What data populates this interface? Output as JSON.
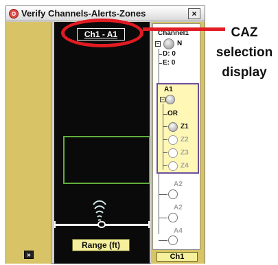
{
  "window": {
    "title": "Verify Channels-Alerts-Zones",
    "close_label": "×"
  },
  "left_panel": {
    "expand_label": "»"
  },
  "sonar": {
    "caz_display": "Ch1 - A1",
    "range_button": "Range (ft)"
  },
  "tree": {
    "channel_label": "Channel1",
    "channel_node": "N",
    "d_label": "D: 0",
    "e_label": "E: 0",
    "alert_label": "A1",
    "or_label": "OR",
    "zones": [
      "Z1",
      "Z2",
      "Z3",
      "Z4"
    ],
    "a2_label_1": "A2",
    "a2_label_2": "A2",
    "a4_label": "A4",
    "channel_button": "Ch1"
  },
  "annotation": {
    "line1": "CAZ",
    "line2": "selection",
    "line3": "display",
    "accent": "#e11b22"
  }
}
